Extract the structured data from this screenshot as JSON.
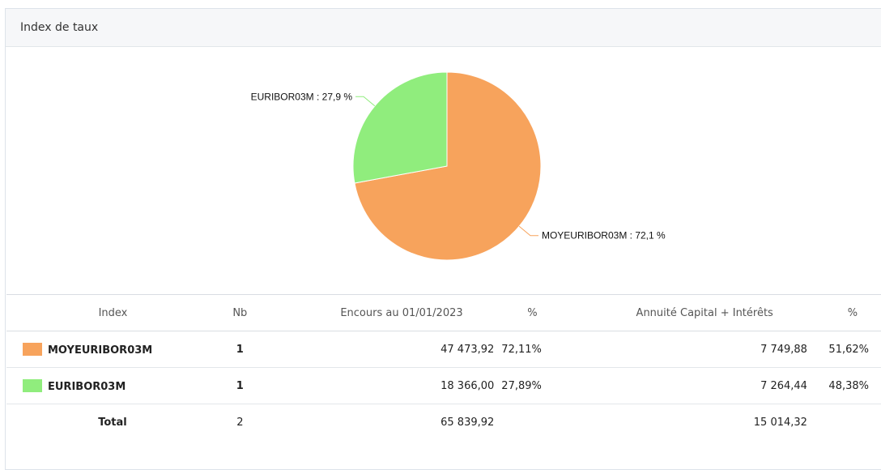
{
  "panel": {
    "title": "Index de taux"
  },
  "chart_data": {
    "type": "pie",
    "title": "",
    "slices": [
      {
        "name": "MOYEURIBOR03M",
        "value": 72.1,
        "label": "MOYEURIBOR03M : 72,1 %",
        "color": "#f7a35c"
      },
      {
        "name": "EURIBOR03M",
        "value": 27.9,
        "label": "EURIBOR03M : 27,9 %",
        "color": "#90ed7d"
      }
    ],
    "start_angle_deg": 0,
    "direction": "clockwise"
  },
  "table": {
    "headers": {
      "index": "Index",
      "nb": "Nb",
      "encours": "Encours au 01/01/2023",
      "pct1": "%",
      "annuite": "Annuité Capital + Intérêts",
      "pct2": "%"
    },
    "rows": [
      {
        "color": "#f7a35c",
        "index": "MOYEURIBOR03M",
        "nb": "1",
        "encours": "47 473,92",
        "pct1": "72,11%",
        "annuite": "7 749,88",
        "pct2": "51,62%"
      },
      {
        "color": "#90ed7d",
        "index": "EURIBOR03M",
        "nb": "1",
        "encours": "18 366,00",
        "pct1": "27,89%",
        "annuite": "7 264,44",
        "pct2": "48,38%"
      }
    ],
    "total": {
      "label": "Total",
      "nb": "2",
      "encours": "65 839,92",
      "annuite": "15 014,32"
    }
  }
}
